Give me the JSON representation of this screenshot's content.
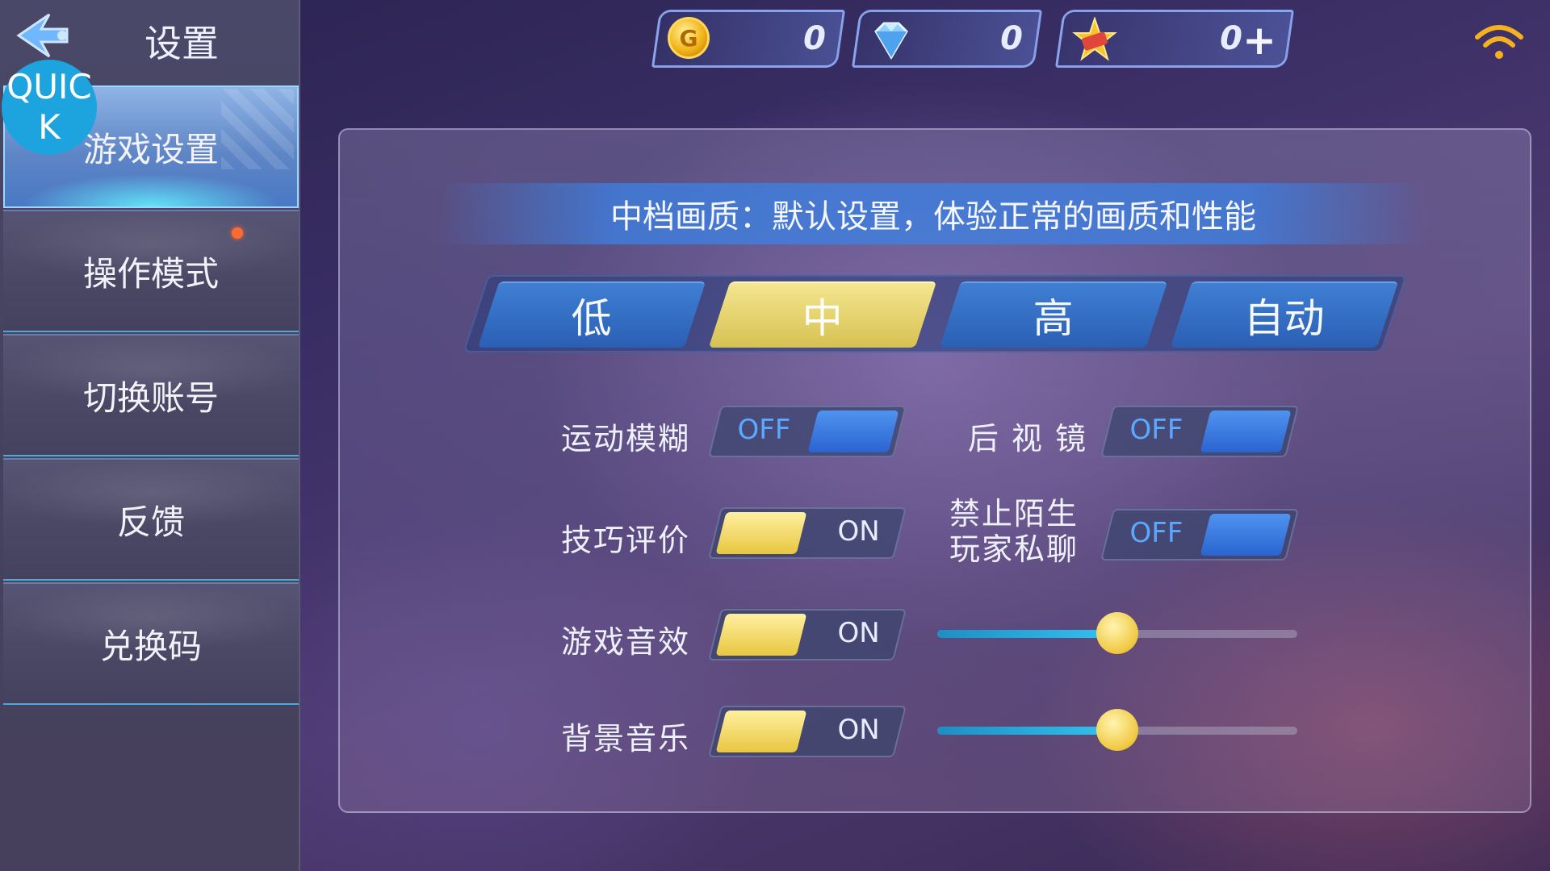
{
  "sidebar": {
    "title": "设置",
    "quick_badge": [
      "QUIC",
      "K"
    ],
    "items": [
      {
        "label": "游戏设置",
        "active": true
      },
      {
        "label": "操作模式",
        "active": false,
        "notice": true
      },
      {
        "label": "切换账号",
        "active": false
      },
      {
        "label": "反馈",
        "active": false
      },
      {
        "label": "兑换码",
        "active": false
      }
    ]
  },
  "currency": {
    "gold": {
      "icon": "gold-coin-icon",
      "value": "0"
    },
    "diamond": {
      "icon": "diamond-icon",
      "value": "0"
    },
    "ticket": {
      "icon": "ticket-icon",
      "value": "0"
    }
  },
  "graphics": {
    "description": "中档画质：默认设置，体验正常的画质和性能",
    "options": [
      "低",
      "中",
      "高",
      "自动"
    ],
    "selected": "中"
  },
  "settings": {
    "motion_blur": {
      "label": "运动模糊",
      "state": "OFF"
    },
    "rear_mirror": {
      "label": "后 视 镜",
      "state": "OFF"
    },
    "skill_rating": {
      "label": "技巧评价",
      "state": "ON"
    },
    "block_stranger_chat": {
      "label_line1": "禁止陌生",
      "label_line2": "玩家私聊",
      "state": "OFF"
    },
    "sound_effects": {
      "label": "游戏音效",
      "state": "ON",
      "volume": 0.5
    },
    "background_music": {
      "label": "背景音乐",
      "state": "ON",
      "volume": 0.5
    }
  },
  "colors": {
    "accent_blue": "#3f7fd4",
    "accent_gold": "#e8c640",
    "off_text": "#5aa8ff"
  }
}
